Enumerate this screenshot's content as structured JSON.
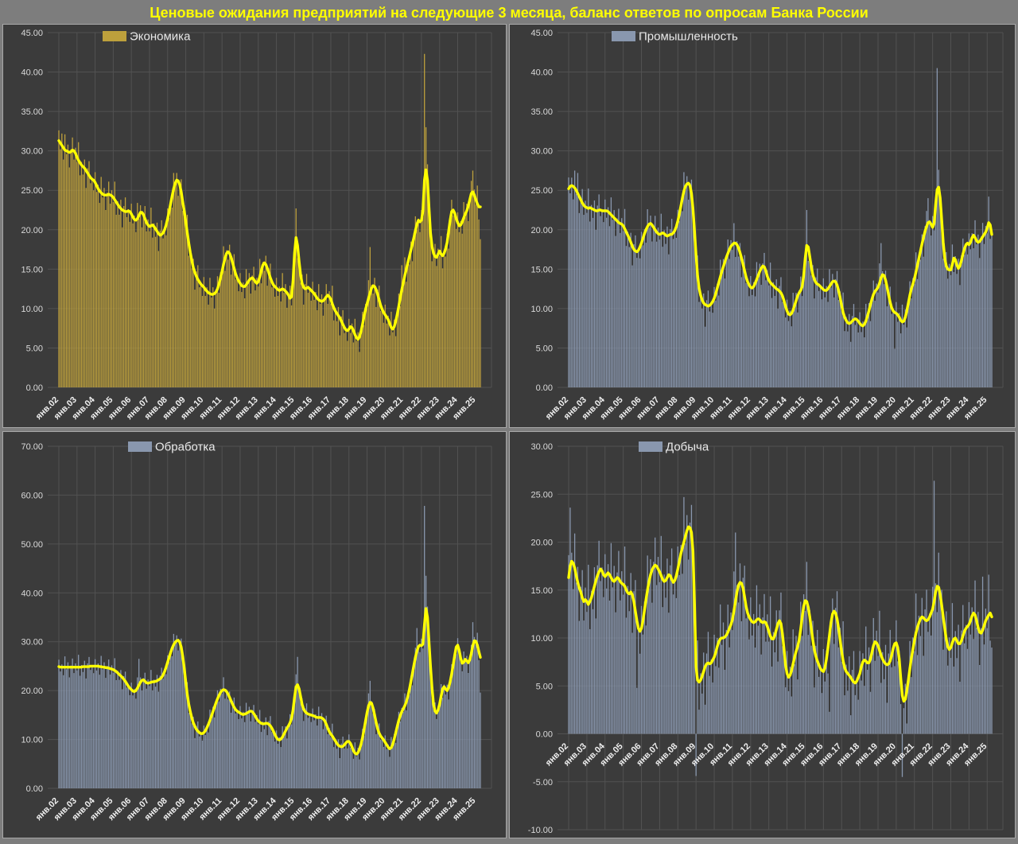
{
  "title": "Ценовые ожидания предприятий на следующие 3 месяца, баланс ответов по опросам Банка России",
  "colors": {
    "background": "#7d7d7d",
    "panel_background": "#3b3b3b",
    "panel_border": "#a8a8a8",
    "grid_line": "#525252",
    "axis_text": "#d9d9d9",
    "x_label_text": "#efefef",
    "legend_text": "#e9e9e9",
    "title_text": "#ffff00",
    "trend_line": "#ffff00",
    "economy_bar": "#bda03c",
    "industry_bar": "#8997ae"
  },
  "x_labels": [
    "янв.02",
    "янв.03",
    "янв.04",
    "янв.05",
    "янв.06",
    "янв.07",
    "янв.08",
    "янв.09",
    "янв.10",
    "янв.11",
    "янв.12",
    "янв.13",
    "янв.14",
    "янв.15",
    "янв.16",
    "янв.17",
    "янв.18",
    "янв.19",
    "янв.20",
    "янв.21",
    "янв.22",
    "янв.23",
    "янв.24",
    "янв.25"
  ],
  "frequency": "monthly",
  "months_range": {
    "start": "янв.02",
    "end": "апр.25"
  },
  "bar_noise_pattern": [
    1.3,
    -0.8,
    0.5,
    -1.5,
    2.0,
    -0.4,
    0.9,
    -1.9,
    0.3,
    1.6,
    -1.1,
    0.7,
    -0.6,
    2.3,
    -1.6,
    0.4,
    -1.0,
    1.1,
    -2.2,
    0.6,
    1.8,
    -0.7,
    0.2,
    -1.3
  ],
  "chart_data": [
    {
      "type": "bar+line",
      "title": "Экономика",
      "bar_color": "#bda03c",
      "line_color": "#ffff00",
      "ylim": [
        0,
        45
      ],
      "ystep": 5,
      "legend_position": "top-center",
      "grid": true,
      "bar_noise_amp": 1.0,
      "bar_outliers": {
        "2": 32.2,
        "157": 22.7,
        "206": 17.8,
        "227": 15.5,
        "242": 42.3,
        "243": 33.0,
        "260": 23.8,
        "274": 27.5,
        "279": 18.8
      },
      "line": [
        31.3,
        31.0,
        30.7,
        30.4,
        30.1,
        30.0,
        29.9,
        29.8,
        29.9,
        30.1,
        30.0,
        29.7,
        29.2,
        28.8,
        28.5,
        28.2,
        28.0,
        27.8,
        27.5,
        27.2,
        26.9,
        26.6,
        26.4,
        26.3,
        26.0,
        25.6,
        25.2,
        24.9,
        24.7,
        24.5,
        24.4,
        24.4,
        24.4,
        24.5,
        24.4,
        24.3,
        24.1,
        23.8,
        23.5,
        23.2,
        22.9,
        22.7,
        22.5,
        22.4,
        22.3,
        22.3,
        22.4,
        22.3,
        22.0,
        21.6,
        21.3,
        21.2,
        21.4,
        21.8,
        22.2,
        22.2,
        21.9,
        21.4,
        20.9,
        20.6,
        20.4,
        20.5,
        20.6,
        20.4,
        20.1,
        19.8,
        19.5,
        19.3,
        19.4,
        19.6,
        20.0,
        20.6,
        21.4,
        22.3,
        23.3,
        24.3,
        25.2,
        25.9,
        26.3,
        26.2,
        25.7,
        24.8,
        23.5,
        22.4,
        21.0,
        19.6,
        18.3,
        17.1,
        16.1,
        15.2,
        14.6,
        14.1,
        13.7,
        13.4,
        13.1,
        12.9,
        12.7,
        12.4,
        12.2,
        12.0,
        11.9,
        11.8,
        11.8,
        11.9,
        12.1,
        12.5,
        13.1,
        13.9,
        14.7,
        15.6,
        16.4,
        17.0,
        17.2,
        17.0,
        16.5,
        15.8,
        15.1,
        14.4,
        13.9,
        13.5,
        13.2,
        12.9,
        12.8,
        12.8,
        13.0,
        13.3,
        13.6,
        13.8,
        13.9,
        13.7,
        13.4,
        13.2,
        13.4,
        14.0,
        14.8,
        15.5,
        15.8,
        15.6,
        15.1,
        14.5,
        13.9,
        13.4,
        13.0,
        12.8,
        12.6,
        12.4,
        12.3,
        12.4,
        12.5,
        12.4,
        12.2,
        12.0,
        11.7,
        11.3,
        11.5,
        13.5,
        17.0,
        19.0,
        18.0,
        16.0,
        14.3,
        13.2,
        12.7,
        12.5,
        12.6,
        12.7,
        12.5,
        12.3,
        12.1,
        11.9,
        11.6,
        11.3,
        11.1,
        11.0,
        10.9,
        11.0,
        11.2,
        11.5,
        11.7,
        11.5,
        11.2,
        10.6,
        10.1,
        9.7,
        9.4,
        9.1,
        8.8,
        8.4,
        8.0,
        7.6,
        7.3,
        7.2,
        7.4,
        7.7,
        7.6,
        7.2,
        6.7,
        6.3,
        6.1,
        6.4,
        7.1,
        8.0,
        9.0,
        9.9,
        10.6,
        11.3,
        12.0,
        12.6,
        12.9,
        12.8,
        12.4,
        11.8,
        11.1,
        10.4,
        9.9,
        9.5,
        9.2,
        8.9,
        8.6,
        8.1,
        7.6,
        7.4,
        7.7,
        8.4,
        9.3,
        10.3,
        11.4,
        12.4,
        13.3,
        14.2,
        15.0,
        15.8,
        16.6,
        17.4,
        18.2,
        19.0,
        19.9,
        20.7,
        21.2,
        21.0,
        21.2,
        22.4,
        26.3,
        27.6,
        26.3,
        22.8,
        19.6,
        17.9,
        17.0,
        16.6,
        16.5,
        16.9,
        17.3,
        16.9,
        16.7,
        17.0,
        17.6,
        18.4,
        19.8,
        21.2,
        22.3,
        22.5,
        22.1,
        21.4,
        20.9,
        20.5,
        20.6,
        21.0,
        21.5,
        22.0,
        22.4,
        23.0,
        23.8,
        24.6,
        24.8,
        24.4,
        23.8,
        23.3,
        22.9,
        22.9
      ]
    },
    {
      "type": "bar+line",
      "title": "Промышленность",
      "bar_color": "#8997ae",
      "line_color": "#ffff00",
      "ylim": [
        0,
        45
      ],
      "ystep": 5,
      "legend_position": "top-center",
      "grid": true,
      "bar_noise_amp": 1.1,
      "bar_outliers": {
        "2": 26.6,
        "6": 27.2,
        "76": 27.3,
        "90": 7.7,
        "157": 22.5,
        "206": 18.3,
        "215": 4.9,
        "237": 24.0,
        "243": 40.5,
        "277": 24.2
      },
      "line": [
        25.2,
        25.5,
        25.6,
        25.5,
        25.3,
        25.0,
        24.6,
        24.2,
        23.8,
        23.4,
        23.1,
        22.9,
        22.8,
        22.7,
        22.8,
        22.7,
        22.6,
        22.5,
        22.4,
        22.4,
        22.5,
        22.5,
        22.4,
        22.4,
        22.4,
        22.4,
        22.3,
        22.1,
        21.9,
        21.7,
        21.5,
        21.3,
        21.1,
        20.9,
        20.8,
        20.7,
        20.5,
        20.1,
        19.7,
        19.3,
        18.9,
        18.4,
        17.9,
        17.5,
        17.3,
        17.2,
        17.4,
        17.8,
        18.3,
        18.9,
        19.5,
        20.0,
        20.4,
        20.7,
        20.8,
        20.6,
        20.3,
        20.0,
        19.7,
        19.5,
        19.4,
        19.5,
        19.6,
        19.5,
        19.3,
        19.2,
        19.3,
        19.4,
        19.4,
        19.6,
        19.9,
        20.4,
        21.1,
        22.0,
        23.0,
        24.0,
        24.9,
        25.5,
        25.8,
        25.9,
        25.6,
        24.6,
        22.6,
        19.8,
        16.8,
        14.2,
        12.6,
        11.7,
        11.1,
        10.7,
        10.5,
        10.4,
        10.3,
        10.4,
        10.6,
        10.9,
        11.3,
        11.9,
        12.6,
        13.3,
        14.0,
        14.7,
        15.3,
        15.9,
        16.5,
        17.0,
        17.5,
        17.9,
        18.1,
        18.3,
        18.3,
        18.1,
        17.7,
        17.1,
        16.4,
        15.6,
        14.8,
        14.0,
        13.4,
        13.0,
        12.7,
        12.6,
        12.8,
        13.2,
        13.7,
        14.2,
        14.7,
        15.1,
        15.4,
        15.3,
        14.8,
        14.1,
        13.6,
        13.3,
        13.1,
        12.9,
        12.7,
        12.5,
        12.4,
        12.2,
        12.0,
        11.6,
        11.0,
        10.3,
        9.7,
        9.3,
        9.2,
        9.4,
        9.8,
        10.4,
        11.0,
        11.6,
        12.0,
        12.3,
        12.8,
        14.2,
        16.4,
        18.0,
        17.8,
        16.6,
        15.3,
        14.3,
        13.7,
        13.3,
        13.1,
        13.0,
        12.8,
        12.6,
        12.4,
        12.3,
        12.3,
        12.5,
        12.8,
        13.1,
        13.4,
        13.5,
        13.4,
        13.0,
        12.3,
        11.4,
        10.4,
        9.5,
        8.9,
        8.5,
        8.2,
        8.1,
        8.2,
        8.4,
        8.6,
        8.7,
        8.6,
        8.4,
        8.1,
        7.9,
        7.8,
        8.0,
        8.4,
        9.0,
        9.7,
        10.5,
        11.2,
        11.8,
        12.2,
        12.4,
        12.7,
        13.2,
        13.9,
        14.3,
        14.2,
        13.6,
        12.7,
        11.7,
        10.8,
        10.1,
        9.7,
        9.5,
        9.4,
        9.2,
        8.9,
        8.5,
        8.3,
        8.4,
        8.9,
        9.7,
        10.7,
        11.7,
        12.5,
        13.1,
        13.8,
        14.6,
        15.5,
        16.4,
        17.3,
        18.2,
        19.0,
        19.8,
        20.4,
        20.9,
        21.0,
        20.7,
        20.3,
        20.8,
        23.2,
        25.1,
        25.4,
        24.0,
        21.2,
        18.4,
        16.4,
        15.4,
        15.0,
        14.9,
        14.9,
        15.6,
        16.4,
        16.2,
        15.5,
        15.1,
        15.4,
        16.1,
        16.9,
        17.6,
        18.1,
        18.3,
        18.1,
        18.4,
        19.0,
        19.3,
        19.0,
        18.6,
        18.4,
        18.5,
        18.8,
        19.1,
        19.4,
        19.7,
        20.2,
        20.9,
        20.6,
        19.4
      ]
    },
    {
      "type": "bar+line",
      "title": "Обработка",
      "bar_color": "#8997ae",
      "line_color": "#ffff00",
      "ylim": [
        0,
        70
      ],
      "ystep": 10,
      "legend_position": "top-center",
      "grid": true,
      "bar_noise_amp": 1.1,
      "bar_outliers": {
        "53": 26.5,
        "78": 31.3,
        "158": 26.9,
        "206": 22.0,
        "237": 32.8,
        "242": 57.8,
        "243": 43.5,
        "274": 34.0,
        "279": 19.6
      },
      "line": [
        24.9,
        24.8,
        24.8,
        24.8,
        24.8,
        24.8,
        24.8,
        24.8,
        24.8,
        24.8,
        24.8,
        24.8,
        24.8,
        24.8,
        24.8,
        24.8,
        24.9,
        24.9,
        24.9,
        24.9,
        24.9,
        25.0,
        25.0,
        25.0,
        25.0,
        25.0,
        25.0,
        24.9,
        24.9,
        24.8,
        24.8,
        24.7,
        24.7,
        24.6,
        24.5,
        24.4,
        24.3,
        24.1,
        23.9,
        23.6,
        23.3,
        23.0,
        22.7,
        22.3,
        21.9,
        21.4,
        20.9,
        20.5,
        20.2,
        19.9,
        19.8,
        20.0,
        20.5,
        21.1,
        21.7,
        22.1,
        22.2,
        21.9,
        21.6,
        21.5,
        21.6,
        21.7,
        21.8,
        21.8,
        21.9,
        22.0,
        22.2,
        22.4,
        22.7,
        23.2,
        23.9,
        24.8,
        25.8,
        26.8,
        27.8,
        28.7,
        29.4,
        29.9,
        30.2,
        30.3,
        29.9,
        28.9,
        27.0,
        24.6,
        21.8,
        19.2,
        17.2,
        15.7,
        14.4,
        13.4,
        12.7,
        12.1,
        11.7,
        11.4,
        11.2,
        11.2,
        11.4,
        11.8,
        12.4,
        13.1,
        13.9,
        14.8,
        15.7,
        16.6,
        17.5,
        18.3,
        19.0,
        19.6,
        20.0,
        20.2,
        20.1,
        19.8,
        19.3,
        18.6,
        17.9,
        17.2,
        16.6,
        16.1,
        15.8,
        15.6,
        15.4,
        15.2,
        15.1,
        15.2,
        15.3,
        15.5,
        15.7,
        15.8,
        15.7,
        15.3,
        14.8,
        14.2,
        13.8,
        13.5,
        13.3,
        13.2,
        13.2,
        13.3,
        13.3,
        13.1,
        12.8,
        12.3,
        11.7,
        11.0,
        10.4,
        10.0,
        9.9,
        10.1,
        10.5,
        11.1,
        11.7,
        12.3,
        12.8,
        13.4,
        14.3,
        16.0,
        18.6,
        20.8,
        21.2,
        20.4,
        18.8,
        17.2,
        16.2,
        15.7,
        15.4,
        15.2,
        15.1,
        15.0,
        14.9,
        14.8,
        14.6,
        14.5,
        14.5,
        14.5,
        14.4,
        14.2,
        13.8,
        13.1,
        12.3,
        11.6,
        11.1,
        10.7,
        10.2,
        9.7,
        9.2,
        8.8,
        8.6,
        8.5,
        8.6,
        8.9,
        9.3,
        9.6,
        9.6,
        9.2,
        8.5,
        7.7,
        7.2,
        7.0,
        7.3,
        8.0,
        9.0,
        10.4,
        12.0,
        13.8,
        15.5,
        16.9,
        17.6,
        17.4,
        16.4,
        15.0,
        13.5,
        12.2,
        11.3,
        10.7,
        10.3,
        9.9,
        9.4,
        8.9,
        8.4,
        8.1,
        8.3,
        9.0,
        10.1,
        11.4,
        12.7,
        13.9,
        14.9,
        15.7,
        16.3,
        16.9,
        17.7,
        18.8,
        20.2,
        21.8,
        23.5,
        25.2,
        26.8,
        28.1,
        29.0,
        29.3,
        29.2,
        29.5,
        33.5,
        36.8,
        35.0,
        30.0,
        25.0,
        20.5,
        17.2,
        15.8,
        15.4,
        16.0,
        17.2,
        18.8,
        20.3,
        20.8,
        20.3,
        20.0,
        20.6,
        21.8,
        23.4,
        25.2,
        27.2,
        28.9,
        29.3,
        28.2,
        26.6,
        25.6,
        25.8,
        26.4,
        26.1,
        25.7,
        26.3,
        27.6,
        29.2,
        30.2,
        30.1,
        29.3,
        28.0,
        26.8
      ]
    },
    {
      "type": "bar+line",
      "title": "Добыча",
      "bar_color": "#8997ae",
      "line_color": "#ffff00",
      "ylim": [
        -10,
        30
      ],
      "ystep": 5,
      "legend_position": "top-center",
      "grid": true,
      "bar_noise_amp": 1.8,
      "bar_outliers": {
        "1": 23.6,
        "45": 4.8,
        "76": 24.7,
        "84": -4.4,
        "110": 21.0,
        "172": 2.3,
        "220": -4.5,
        "241": 26.4,
        "273": 16.4,
        "277": 16.6,
        "279": 9.0
      },
      "line": [
        16.3,
        17.5,
        18.0,
        17.8,
        17.3,
        16.5,
        15.8,
        15.2,
        14.8,
        14.2,
        13.8,
        14.0,
        13.8,
        13.5,
        13.8,
        14.2,
        14.8,
        15.4,
        16.0,
        16.5,
        16.9,
        17.2,
        17.0,
        16.6,
        16.4,
        16.6,
        16.8,
        16.6,
        16.3,
        16.0,
        15.9,
        16.1,
        16.3,
        16.2,
        15.9,
        15.7,
        15.6,
        15.4,
        15.0,
        14.7,
        14.6,
        14.8,
        14.5,
        13.8,
        12.8,
        11.8,
        11.0,
        10.7,
        11.0,
        11.8,
        12.9,
        14.0,
        15.0,
        15.9,
        16.6,
        17.1,
        17.4,
        17.6,
        17.5,
        17.2,
        16.9,
        16.5,
        16.1,
        15.9,
        16.0,
        16.3,
        16.6,
        16.5,
        16.1,
        15.8,
        16.0,
        16.5,
        17.2,
        18.0,
        18.8,
        19.4,
        20.0,
        20.6,
        21.2,
        21.6,
        21.5,
        21.0,
        19.0,
        13.5,
        7.0,
        5.6,
        5.4,
        5.6,
        6.0,
        6.5,
        7.0,
        7.3,
        7.4,
        7.3,
        7.4,
        7.7,
        8.0,
        8.5,
        9.1,
        9.6,
        9.9,
        10.0,
        10.0,
        10.1,
        10.3,
        10.6,
        11.0,
        11.4,
        11.9,
        12.8,
        13.8,
        14.8,
        15.5,
        15.8,
        15.7,
        15.2,
        14.3,
        13.3,
        12.6,
        12.2,
        11.9,
        11.7,
        11.6,
        11.7,
        11.9,
        12.0,
        11.9,
        11.7,
        11.6,
        11.7,
        11.6,
        11.2,
        10.7,
        10.2,
        9.9,
        9.9,
        10.3,
        10.9,
        11.5,
        11.8,
        11.5,
        10.4,
        8.9,
        7.2,
        6.3,
        5.9,
        6.1,
        6.6,
        7.3,
        8.0,
        8.6,
        9.1,
        9.8,
        10.9,
        12.2,
        13.3,
        13.9,
        13.8,
        13.2,
        12.2,
        11.0,
        9.8,
        8.8,
        8.1,
        7.6,
        7.2,
        6.8,
        6.6,
        6.5,
        6.9,
        7.8,
        9.0,
        10.3,
        11.6,
        12.5,
        12.8,
        12.6,
        12.0,
        11.0,
        9.8,
        8.6,
        7.6,
        6.9,
        6.5,
        6.3,
        6.1,
        5.9,
        5.6,
        5.4,
        5.3,
        5.5,
        5.9,
        6.3,
        7.0,
        7.5,
        7.7,
        7.6,
        7.4,
        7.4,
        7.8,
        8.5,
        9.2,
        9.6,
        9.5,
        9.2,
        8.7,
        8.2,
        7.8,
        7.5,
        7.3,
        7.2,
        7.3,
        7.6,
        8.2,
        8.9,
        9.4,
        9.5,
        9.0,
        7.8,
        5.8,
        4.0,
        3.4,
        3.6,
        4.5,
        5.6,
        6.8,
        7.9,
        8.8,
        9.7,
        10.5,
        11.1,
        11.6,
        12.0,
        12.2,
        12.1,
        11.9,
        11.8,
        11.9,
        12.2,
        12.6,
        13.0,
        13.8,
        14.8,
        15.4,
        15.3,
        14.5,
        13.4,
        12.2,
        11.0,
        9.9,
        9.1,
        8.8,
        9.0,
        9.5,
        9.9,
        10.0,
        9.7,
        9.4,
        9.4,
        9.7,
        10.2,
        10.7,
        11.0,
        11.2,
        11.4,
        11.8,
        12.3,
        12.6,
        12.4,
        11.8,
        11.1,
        10.6,
        10.5,
        10.8,
        11.3,
        11.8,
        12.1,
        12.4,
        12.6,
        12.2
      ]
    }
  ]
}
